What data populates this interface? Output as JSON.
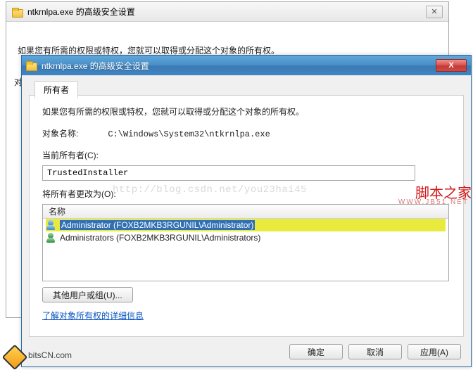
{
  "outer": {
    "title": "ntkrnlpa.exe 的高级安全设置",
    "body_text": "如果您有所需的权限或特权，您就可以取得或分配这个对象的所有权。"
  },
  "front": {
    "title": "ntkrnlpa.exe 的高级安全设置",
    "tab_owner": "所有者",
    "intro": "如果您有所需的权限或特权，您就可以取得或分配这个对象的所有权。",
    "object_name_label": "对象名称:",
    "object_name_value": "C:\\Windows\\System32\\ntkrnlpa.exe",
    "current_owner_label": "当前所有者(C):",
    "current_owner_value": "TrustedInstaller",
    "change_to_label": "将所有者更改为(O):",
    "list_header": "名称",
    "owners": [
      {
        "label": "Administrator (FOXB2MKB3RGUNIL\\Administrator)",
        "selected": true,
        "type": "user"
      },
      {
        "label": "Administrators (FOXB2MKB3RGUNIL\\Administrators)",
        "selected": false,
        "type": "group"
      }
    ],
    "other_users_btn": "其他用户或组(U)...",
    "learn_link": "了解对象所有权的详细信息",
    "ok_btn": "确定",
    "cancel_btn": "取消",
    "apply_btn": "应用(A)"
  },
  "side_text": "对",
  "watermark": {
    "url": "http://blog.csdn.net/you23hai45",
    "brand": "脚本之家",
    "brand_sub": "WWW.JB51.NET"
  },
  "logo_text": "bitsCN.com"
}
